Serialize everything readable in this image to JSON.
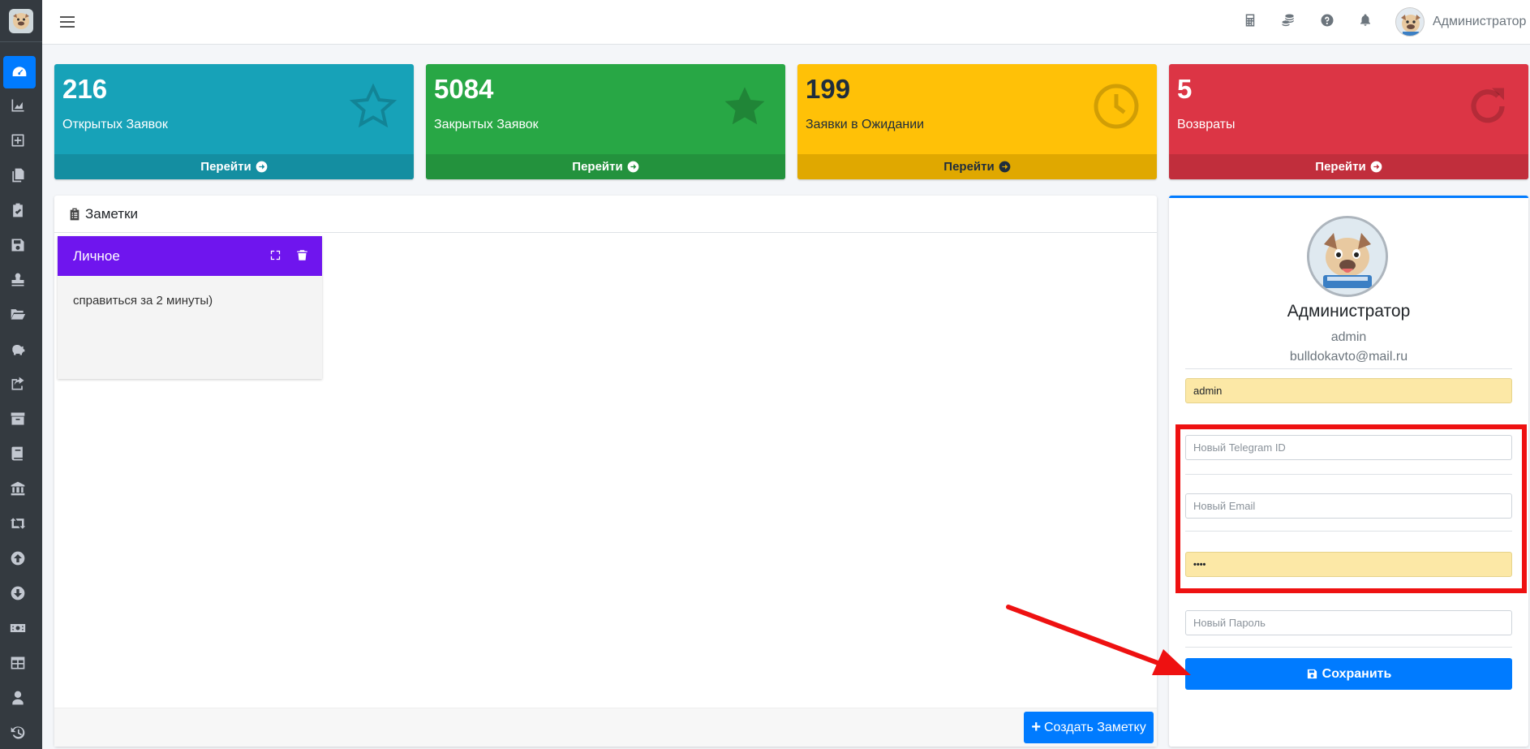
{
  "topbar": {
    "user_name": "Администратор"
  },
  "sidebar": {
    "items": [
      "dashboard-icon",
      "chart-area-icon",
      "plus-square-icon",
      "copy-icon",
      "clipboard-check-icon",
      "save-icon",
      "stamp-icon",
      "folder-open-icon",
      "piggy-bank-icon",
      "share-square-icon",
      "archive-icon",
      "book-icon",
      "university-icon",
      "retweet-icon",
      "arrow-circle-up-icon",
      "arrow-circle-down-icon",
      "money-bill-icon",
      "table-icon",
      "user-icon",
      "history-icon"
    ]
  },
  "stats": [
    {
      "value": "216",
      "label": "Открытых Заявок",
      "link": "Перейти",
      "color": "#17a2b8"
    },
    {
      "value": "5084",
      "label": "Закрытых Заявок",
      "link": "Перейти",
      "color": "#28a745"
    },
    {
      "value": "199",
      "label": "Заявки в Ожидании",
      "link": "Перейти",
      "color": "#ffc107"
    },
    {
      "value": "5",
      "label": "Возвраты",
      "link": "Перейти",
      "color": "#dc3545"
    }
  ],
  "notes": {
    "title": "Заметки",
    "items": [
      {
        "title": "Личное",
        "text": "справиться за 2 минуты)"
      }
    ],
    "create_label": "Создать Заметку"
  },
  "profile": {
    "name": "Администратор",
    "login": "admin",
    "email": "bulldokavto@mail.ru",
    "login_field_value": "admin",
    "telegram_placeholder": "Новый Telegram ID",
    "email_placeholder": "Новый Email",
    "password_value": "••••",
    "new_password_placeholder": "Новый Пароль",
    "save_label": "Сохранить"
  },
  "annotation": {
    "highlight_color": "#ee1111"
  }
}
